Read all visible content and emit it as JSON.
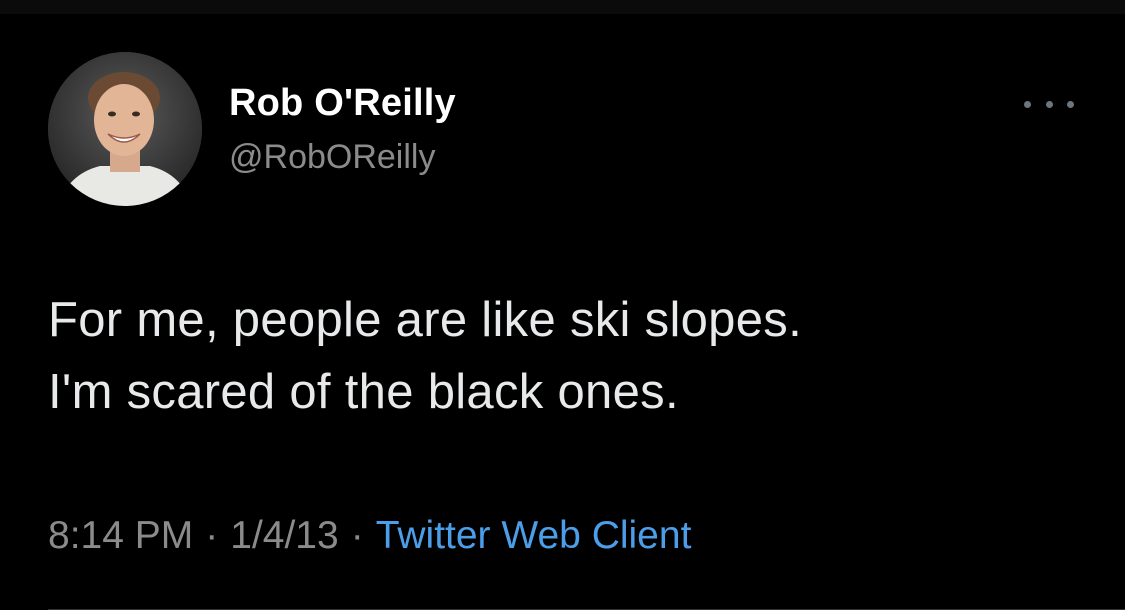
{
  "tweet": {
    "author_name": "Rob O'Reilly",
    "author_handle": "@RobOReilly",
    "text_lines": [
      "For me, people are like ski slopes.",
      "I'm scared of the black ones."
    ],
    "time": "8:14 PM",
    "separator": "·",
    "date": "1/4/13",
    "client": "Twitter Web Client"
  },
  "icons": {
    "more": "more-horizontal-icon"
  },
  "colors": {
    "background": "#000000",
    "text": "#e7e9ea",
    "muted": "#8b8b8b",
    "link": "#4c9ee8"
  }
}
